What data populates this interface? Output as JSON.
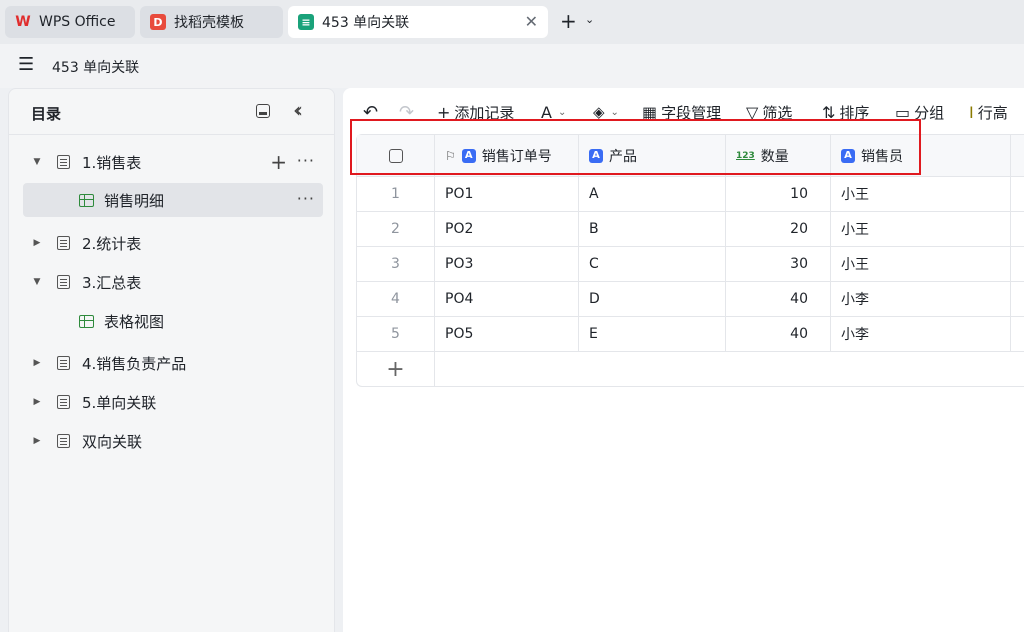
{
  "tabs": [
    {
      "label": "WPS Office",
      "icon": "wps-logo-icon",
      "color": "#e02d2d"
    },
    {
      "label": "找稻壳模板",
      "icon": "docer-logo-icon",
      "color": "#e84b3c"
    },
    {
      "label": "453 单向关联",
      "icon": "table-app-icon",
      "color": "#1aa27a"
    }
  ],
  "header": {
    "title": "453 单向关联"
  },
  "sidebar": {
    "title": "目录",
    "items": [
      {
        "label": "1.销售表",
        "expanded": true
      },
      {
        "label": "销售明细",
        "child": true,
        "active": true
      },
      {
        "label": "2.统计表",
        "expanded": false
      },
      {
        "label": "3.汇总表",
        "expanded": true
      },
      {
        "label": "表格视图",
        "child": true
      },
      {
        "label": "4.销售负责产品",
        "expanded": false
      },
      {
        "label": "5.单向关联",
        "expanded": false
      },
      {
        "label": "双向关联",
        "expanded": false
      }
    ]
  },
  "toolbar": {
    "undo": "↶",
    "redo": "↷",
    "add_record": "添加记录",
    "font": "A",
    "fill": "◈",
    "field_manage": "字段管理",
    "filter": "筛选",
    "sort": "排序",
    "group": "分组",
    "row_height": "行高"
  },
  "table": {
    "columns": [
      {
        "label": "销售订单号",
        "type": "text",
        "primary": true
      },
      {
        "label": "产品",
        "type": "text"
      },
      {
        "label": "数量",
        "type": "number"
      },
      {
        "label": "销售员",
        "type": "text"
      }
    ],
    "type_badge_text": "A",
    "type_badge_number": "123",
    "rows": [
      {
        "index": "1",
        "order": "PO1",
        "product": "A",
        "qty": "10",
        "seller": "小王"
      },
      {
        "index": "2",
        "order": "PO2",
        "product": "B",
        "qty": "20",
        "seller": "小王"
      },
      {
        "index": "3",
        "order": "PO3",
        "product": "C",
        "qty": "30",
        "seller": "小王"
      },
      {
        "index": "4",
        "order": "PO4",
        "product": "D",
        "qty": "40",
        "seller": "小李"
      },
      {
        "index": "5",
        "order": "PO5",
        "product": "E",
        "qty": "40",
        "seller": "小李"
      }
    ]
  },
  "colors": {
    "accent": "#3a6cf4",
    "highlight": "#e0191f",
    "sheet_icon": "#2e8a3c"
  }
}
